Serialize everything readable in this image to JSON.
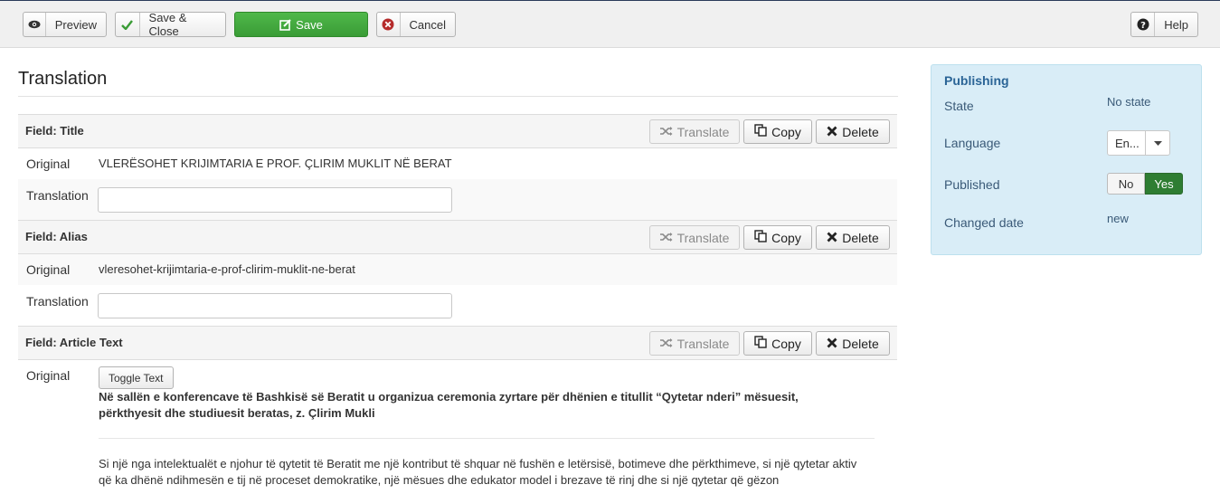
{
  "toolbar": {
    "preview_label": "Preview",
    "save_close_label": "Save & Close",
    "save_label": "Save",
    "cancel_label": "Cancel",
    "help_label": "Help",
    "colors": {
      "save_green": "#3fa53a",
      "cancel_icon": "#b52b2b"
    }
  },
  "page": {
    "title": "Translation"
  },
  "field_buttons": {
    "translate": "Translate",
    "copy": "Copy",
    "delete": "Delete"
  },
  "labels": {
    "original": "Original",
    "translation": "Translation"
  },
  "fields": [
    {
      "name": "Field: Title",
      "original": "VLERËSOHET KRIJIMTARIA E PROF. ÇLIRIM MUKLIT NË BERAT",
      "translation_value": ""
    },
    {
      "name": "Field: Alias",
      "original": "vleresohet-krijimtaria-e-prof-clirim-muklit-ne-berat",
      "translation_value": ""
    },
    {
      "name": "Field: Article Text",
      "toggle_label": "Toggle Text",
      "lead": "Në sallën e konferencave të Bashkisë së Beratit u organizua ceremonia zyrtare për dhënien e titullit “Qytetar nderi” mësuesit, përkthyesit dhe studiuesit beratas, z. Çlirim Mukli",
      "body": "Si një nga intelektualët e njohur të qytetit të Beratit me një kontribut të shquar në fushën e letërsisë, botimeve dhe përkthimeve, si një qytetar aktiv që ka dhënë ndihmesën e tij në proceset demokratike, një mësues dhe edukator model i brezave të rinj dhe si një qytetar që gëzon"
    }
  ],
  "publishing": {
    "heading": "Publishing",
    "state_label": "State",
    "state_value": "No state",
    "language_label": "Language",
    "language_value": "En...",
    "published_label": "Published",
    "published_no": "No",
    "published_yes": "Yes",
    "published_selected": "Yes",
    "changed_label": "Changed date",
    "changed_value": "new"
  }
}
